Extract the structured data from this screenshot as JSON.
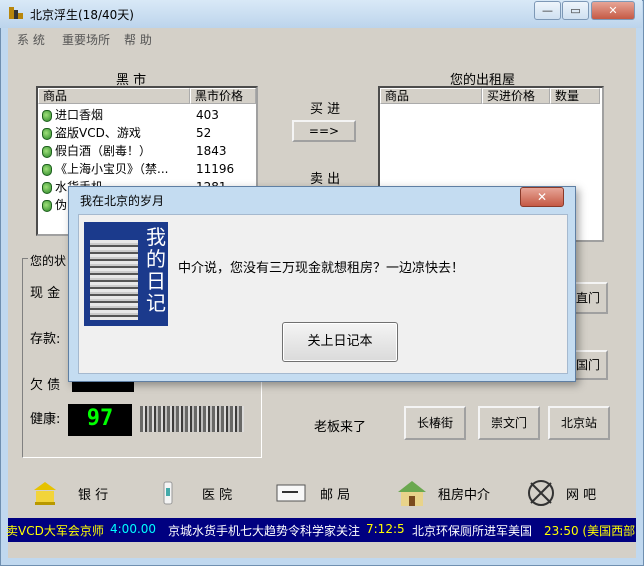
{
  "window": {
    "title": "北京浮生(18/40天)",
    "caption_min": "—",
    "caption_max": "▭",
    "caption_close": "✕"
  },
  "menu": [
    "系 统",
    "重要场所",
    "帮 助"
  ],
  "black_market": {
    "label": "黑 市",
    "headers": [
      "商品",
      "黑市价格"
    ],
    "items": [
      {
        "name": "进口香烟",
        "price": "403"
      },
      {
        "name": "盗版VCD、游戏",
        "price": "52"
      },
      {
        "name": "假白酒（剧毒！）",
        "price": "1843"
      },
      {
        "name": "《上海小宝贝》（禁...",
        "price": "11196"
      },
      {
        "name": "水货手机",
        "price": "1281"
      },
      {
        "name": "伪",
        "price": ""
      }
    ]
  },
  "trade": {
    "buy_label": "买 进",
    "buy_button": "==>",
    "sell_label": "卖 出"
  },
  "my_house": {
    "label": "您的出租屋",
    "headers": [
      "商品",
      "买进价格",
      "数量"
    ]
  },
  "status": {
    "group_label": "您的状",
    "cash_label": "现 金",
    "deposit_label": "存款:",
    "debt_label": "欠 债",
    "health_label": "健康:",
    "health_value": "97"
  },
  "locations": {
    "boss_label": "老板来了",
    "btn_changchun": "长椿街",
    "btn_chongwen": "崇文门",
    "btn_beijing_station": "北京站",
    "btn_right1": "直门",
    "btn_right2": "国门"
  },
  "toolbar": {
    "bank": "银 行",
    "hospital": "医 院",
    "post": "邮 局",
    "rental": "租房中介",
    "netbar": "网 吧"
  },
  "ticker": {
    "items": [
      {
        "text": "卖VCD大军会京师",
        "color": "#ffff00"
      },
      {
        "text": "4:00.00",
        "color": "#00ffff"
      },
      {
        "text": "京城水货手机七大趋势令科学家关注",
        "color": "#ffffff"
      },
      {
        "text": "7:12:5",
        "color": "#ffff00"
      },
      {
        "text": "北京环保厕所进军美国",
        "color": "#ffffff"
      },
      {
        "text": "23:50 (美国西部",
        "color": "#ffff00"
      }
    ]
  },
  "dialog": {
    "title": "我在北京的岁月",
    "close": "✕",
    "image_text": "我的日记",
    "message": "中介说，您没有三万现金就想租房？一边凉快去！",
    "ok_button": "关上日记本"
  }
}
